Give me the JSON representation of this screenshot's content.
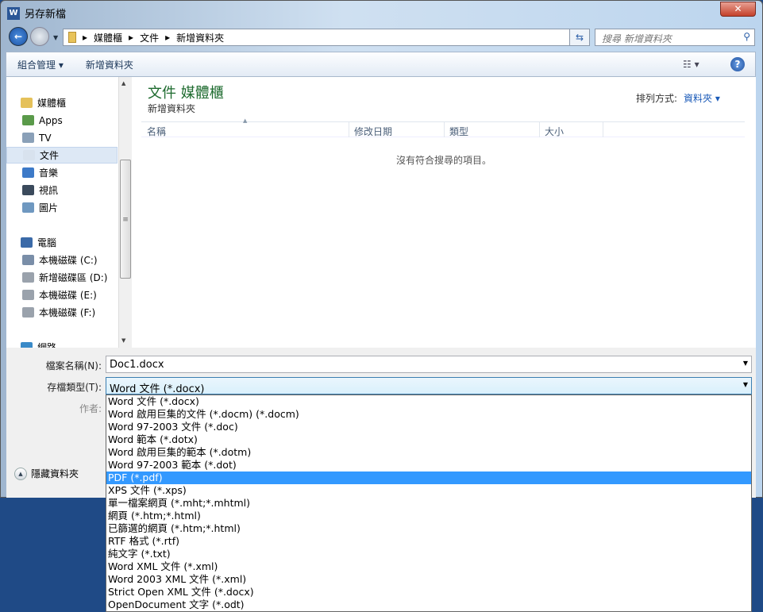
{
  "window": {
    "title": "另存新檔",
    "app_icon": "W"
  },
  "address": {
    "crumbs": [
      "媒體櫃",
      "文件",
      "新增資料夾"
    ]
  },
  "search": {
    "placeholder": "搜尋 新增資料夾"
  },
  "toolbar": {
    "organize": "組合管理 ▾",
    "new_folder": "新增資料夾"
  },
  "sidebar": {
    "items": [
      {
        "label": "媒體櫃",
        "color": "#e5c15a"
      },
      {
        "label": "Apps",
        "color": "#5a9a4a"
      },
      {
        "label": "TV",
        "color": "#8aa0b8"
      },
      {
        "label": "文件",
        "color": "#d8e2ee"
      },
      {
        "label": "音樂",
        "color": "#3d7ac8"
      },
      {
        "label": "視訊",
        "color": "#3b4a5c"
      },
      {
        "label": "圖片",
        "color": "#6f98c0"
      },
      {
        "label": "電腦",
        "color": "#3b6aa8"
      },
      {
        "label": "本機磁碟 (C:)",
        "color": "#7a8ea8"
      },
      {
        "label": "新增磁碟區 (D:)",
        "color": "#9aa2ac"
      },
      {
        "label": "本機磁碟 (E:)",
        "color": "#9aa2ac"
      },
      {
        "label": "本機磁碟 (F:)",
        "color": "#9aa2ac"
      },
      {
        "label": "網路",
        "color": "#3a8ac8"
      }
    ]
  },
  "main": {
    "title": "文件 媒體櫃",
    "subtitle": "新增資料夾",
    "sort_label": "排列方式:",
    "sort_value": "資料夾 ▾",
    "columns": [
      "名稱",
      "修改日期",
      "類型",
      "大小"
    ],
    "empty": "沒有符合搜尋的項目。"
  },
  "form": {
    "filename_label": "檔案名稱(N):",
    "filename": "Doc1.docx",
    "type_label": "存檔類型(T):",
    "type_value": "Word 文件 (*.docx)",
    "author_label": "作者:",
    "hide_folders": "隱藏資料夾"
  },
  "type_options": [
    "Word 文件 (*.docx)",
    "Word 啟用巨集的文件 (*.docm) (*.docm)",
    "Word 97-2003 文件 (*.doc)",
    "Word 範本 (*.dotx)",
    "Word 啟用巨集的範本 (*.dotm)",
    "Word 97-2003 範本 (*.dot)",
    "PDF (*.pdf)",
    "XPS 文件 (*.xps)",
    "單一檔案網頁 (*.mht;*.mhtml)",
    "網頁 (*.htm;*.html)",
    "已篩選的網頁 (*.htm;*.html)",
    "RTF 格式 (*.rtf)",
    "純文字 (*.txt)",
    "Word XML 文件 (*.xml)",
    "Word 2003 XML 文件 (*.xml)",
    "Strict Open XML 文件 (*.docx)",
    "OpenDocument 文字 (*.odt)"
  ],
  "selected_option": 6
}
